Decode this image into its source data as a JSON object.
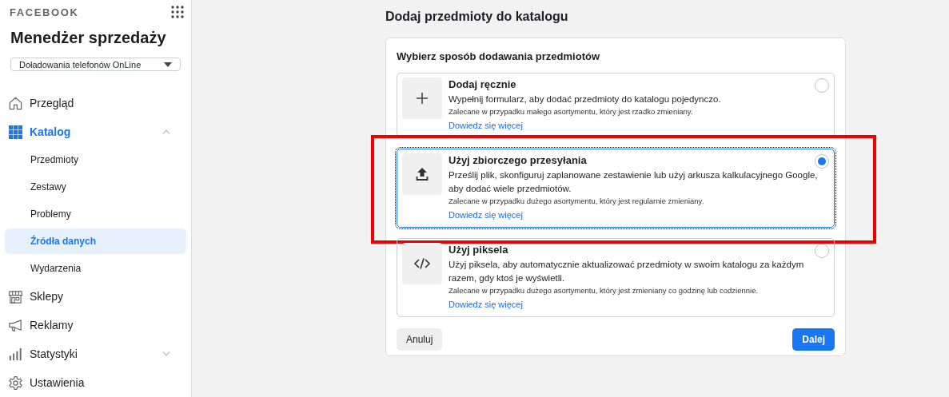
{
  "sidebar": {
    "brand": "FACEBOOK",
    "title": "Menedżer sprzedaży",
    "account_selector": {
      "value": "Doładowania telefonów OnLine"
    },
    "nav": [
      {
        "label": "Przegląd",
        "kind": "home",
        "selected": false
      },
      {
        "label": "Katalog",
        "kind": "grid",
        "selected": true,
        "expanded": true,
        "children": [
          {
            "label": "Przedmioty",
            "selected": false
          },
          {
            "label": "Zestawy",
            "selected": false
          },
          {
            "label": "Problemy",
            "selected": false
          },
          {
            "label": "Źródła danych",
            "selected": true
          },
          {
            "label": "Wydarzenia",
            "selected": false
          }
        ]
      },
      {
        "label": "Sklepy",
        "kind": "store",
        "selected": false
      },
      {
        "label": "Reklamy",
        "kind": "megaphone",
        "selected": false
      },
      {
        "label": "Statystyki",
        "kind": "chart",
        "selected": false,
        "expanded": false
      },
      {
        "label": "Ustawienia",
        "kind": "gear",
        "selected": false
      }
    ]
  },
  "main": {
    "title": "Dodaj przedmioty do katalogu",
    "card": {
      "heading": "Wybierz sposób dodawania przedmiotów",
      "options": [
        {
          "kind": "manual",
          "title": "Dodaj ręcznie",
          "description": "Wypełnij formularz, aby dodać przedmioty do katalogu pojedynczo.",
          "note": "Zalecane w przypadku małego asortymentu, który jest rzadko zmieniany.",
          "link": "Dowiedz się więcej",
          "selected": false
        },
        {
          "kind": "bulk",
          "title": "Użyj zbiorczego przesyłania",
          "description": "Prześlij plik, skonfiguruj zaplanowane zestawienie lub użyj arkusza kalkulacyjnego Google, aby dodać wiele przedmiotów.",
          "note": "Zalecane w przypadku dużego asortymentu, który jest regularnie zmieniany.",
          "link": "Dowiedz się więcej",
          "selected": true,
          "annotated": true
        },
        {
          "kind": "pixel",
          "title": "Użyj piksela",
          "description": "Użyj piksela, aby automatycznie aktualizować przedmioty w swoim katalogu za każdym razem, gdy ktoś je wyświetli.",
          "note": "Zalecane w przypadku dużego asortymentu, który jest zmieniany co godzinę lub codziennie.",
          "link": "Dowiedz się więcej",
          "selected": false
        }
      ],
      "buttons": {
        "cancel": "Anuluj",
        "next": "Dalej"
      }
    }
  }
}
